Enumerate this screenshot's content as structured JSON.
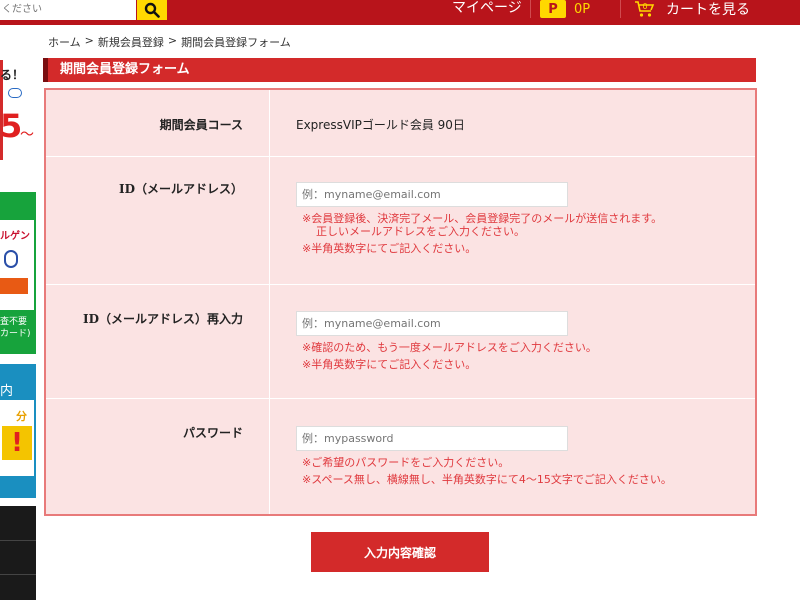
{
  "header": {
    "search_placeholder": "ください",
    "mypage": "マイページ",
    "points_badge": "P",
    "points_value": "0P",
    "cart_count": "0",
    "cart_label": "カートを見る"
  },
  "sidebar": {
    "banner1_line1": "る！",
    "banner1_big": "5",
    "banner1_small": "～",
    "banner2_line1": "ルゲン",
    "banner2_line2": "査不要",
    "banner2_line3": "カード)",
    "banner3_line1": "内",
    "banner3_line2": "分",
    "banner3_line3": "!"
  },
  "breadcrumb": {
    "home": "ホーム",
    "sep1": ">",
    "item1": "新規会員登録",
    "sep2": ">",
    "item2": "期間会員登録フォーム"
  },
  "section": {
    "title": "期間会員登録フォーム"
  },
  "form": {
    "course_label": "期間会員コース",
    "course_value": "ExpressVIPゴールド会員 90日",
    "email_label": "ID（メールアドレス）",
    "email_placeholder": "例：myname@email.com",
    "email_note1": "※会員登録後、決済完了メール、会員登録完了のメールが送信されます。",
    "email_note2": "正しいメールアドレスをご入力ください。",
    "email_note3": "※半角英数字にてご記入ください。",
    "email2_label": "ID（メールアドレス）再入力",
    "email2_placeholder": "例：myname@email.com",
    "email2_note1": "※確認のため、もう一度メールアドレスをご入力ください。",
    "email2_note2": "※半角英数字にてご記入ください。",
    "password_label": "パスワード",
    "password_placeholder": "例：mypassword",
    "password_note1": "※ご希望のパスワードをご入力ください。",
    "password_note2": "※スペース無し、横線無し、半角英数字にて4～15文字でご記入ください。",
    "submit_label": "入力内容確認"
  },
  "colors": {
    "brand_red": "#b8141b",
    "accent_yellow": "#ffd800",
    "form_bg": "#fbe3e3",
    "note_red": "#e0393e"
  }
}
